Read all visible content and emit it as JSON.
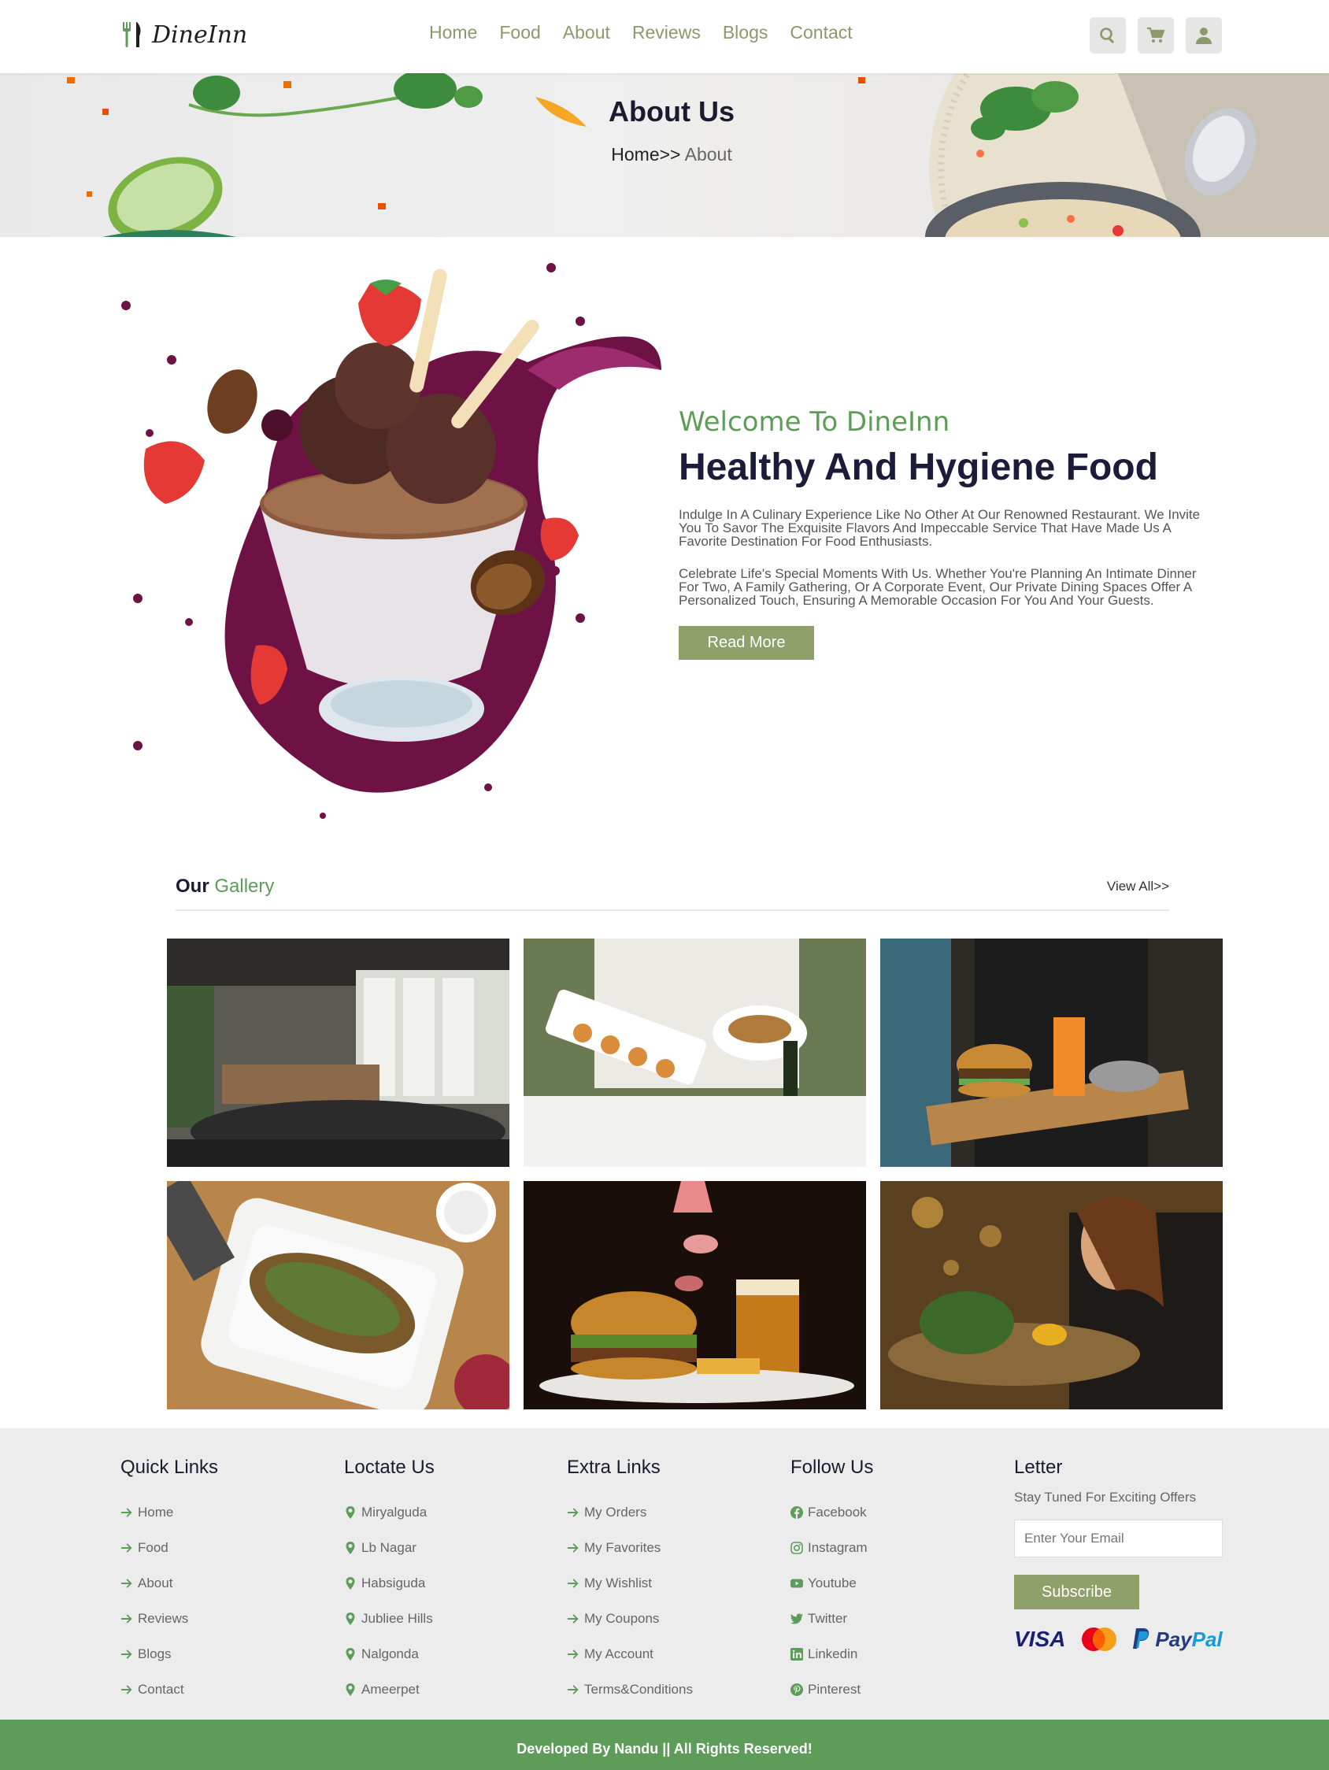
{
  "header": {
    "logo_text": "DineInn",
    "nav": [
      "Home",
      "Food",
      "About",
      "Reviews",
      "Blogs",
      "Contact"
    ]
  },
  "banner": {
    "title": "About Us",
    "crumb_home": "Home>>",
    "crumb_current": "About"
  },
  "about": {
    "welcome": "Welcome To DineInn",
    "headline": "Healthy And Hygiene Food",
    "para1": "Indulge In A Culinary Experience Like No Other At Our Renowned Restaurant. We Invite You To Savor The Exquisite Flavors And Impeccable Service That Have Made Us A Favorite Destination For Food Enthusiasts.",
    "para2": "Celebrate Life's Special Moments With Us. Whether You're Planning An Intimate Dinner For Two, A Family Gathering, Or A Corporate Event, Our Private Dining Spaces Offer A Personalized Touch, Ensuring A Memorable Occasion For You And Your Guests.",
    "button": "Read More"
  },
  "gallery": {
    "title_a": "Our",
    "title_b": "Gallery",
    "view_all": "View All>>"
  },
  "footer": {
    "quick": {
      "title": "Quick Links",
      "items": [
        "Home",
        "Food",
        "About",
        "Reviews",
        "Blogs",
        "Contact"
      ]
    },
    "locate": {
      "title": "Loctate Us",
      "items": [
        "Miryalguda",
        "Lb Nagar",
        "Habsiguda",
        "Jubliee Hills",
        "Nalgonda",
        "Ameerpet"
      ]
    },
    "extra": {
      "title": "Extra Links",
      "items": [
        "My Orders",
        "My Favorites",
        "My Wishlist",
        "My Coupons",
        "My Account",
        "Terms&Conditions"
      ]
    },
    "follow": {
      "title": "Follow Us",
      "items": [
        "Facebook",
        "Instagram",
        "Youtube",
        "Twitter",
        "Linkedin",
        "Pinterest"
      ]
    },
    "letter": {
      "title": "Letter",
      "subtitle": "Stay Tuned For Exciting Offers",
      "placeholder": "Enter Your Email",
      "button": "Subscribe",
      "payments": {
        "visa": "VISA",
        "mastercard": "MasterCard",
        "paypal_a": "Pay",
        "paypal_b": "Pal"
      }
    }
  },
  "copyright": "Developed By Nandu || All Rights Reserved!"
}
